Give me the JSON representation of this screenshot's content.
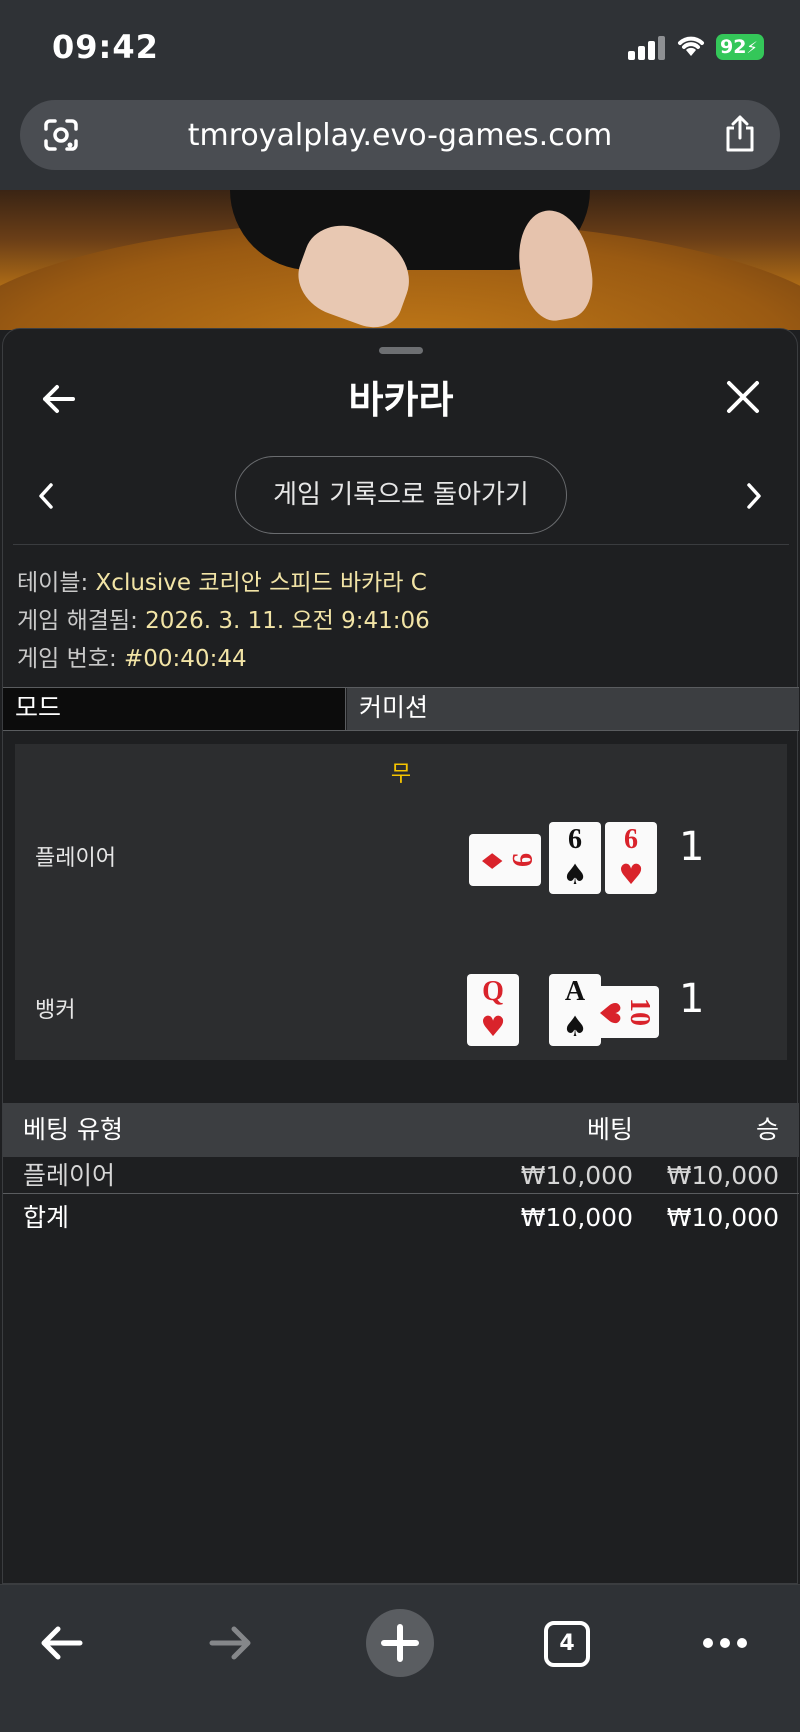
{
  "status": {
    "time": "09:42",
    "battery": "92"
  },
  "browser": {
    "url": "tmroyalplay.evo-games.com"
  },
  "panel": {
    "title": "바카라",
    "history_button": "게임 기록으로 돌아가기",
    "info": {
      "table_label": "테이블: ",
      "table_value": "Xclusive 코리안 스피드 바카라 C",
      "resolved_label": "게임 해결됨: ",
      "resolved_value": "2026. 3. 11. 오전 9:41:06",
      "number_label": "게임 번호: ",
      "number_value": "#00:40:44"
    },
    "tabs": {
      "mode": "모드",
      "commission": "커미션"
    },
    "result": {
      "outcome": "무",
      "player_label": "플레이어",
      "player_score": "1",
      "player_cards": [
        {
          "rank": "9",
          "suit": "♦",
          "color": "red",
          "rotated": true
        },
        {
          "rank": "6",
          "suit": "♠",
          "color": "black",
          "rotated": false
        },
        {
          "rank": "6",
          "suit": "♥",
          "color": "red",
          "rotated": false
        }
      ],
      "banker_label": "뱅커",
      "banker_score": "1",
      "banker_cards": [
        {
          "rank": "Q",
          "suit": "♥",
          "color": "red",
          "rotated": false
        },
        {
          "rank": "A",
          "suit": "♠",
          "color": "black",
          "rotated": false
        },
        {
          "rank": "10",
          "suit": "♥",
          "color": "red",
          "rotated": true
        }
      ]
    },
    "bets": {
      "headers": {
        "type": "베팅 유형",
        "bet": "베팅",
        "win": "승"
      },
      "rows": [
        {
          "type": "플레이어",
          "bet": "₩10,000",
          "win": "₩10,000"
        }
      ],
      "total": {
        "label": "합계",
        "bet": "₩10,000",
        "win": "₩10,000"
      }
    }
  },
  "toolbar": {
    "tab_count": "4"
  },
  "colors": {
    "accent_yellow": "#f5c400",
    "info_value": "#f2e4a6",
    "battery_green": "#34c759",
    "card_red": "#d9232b"
  }
}
